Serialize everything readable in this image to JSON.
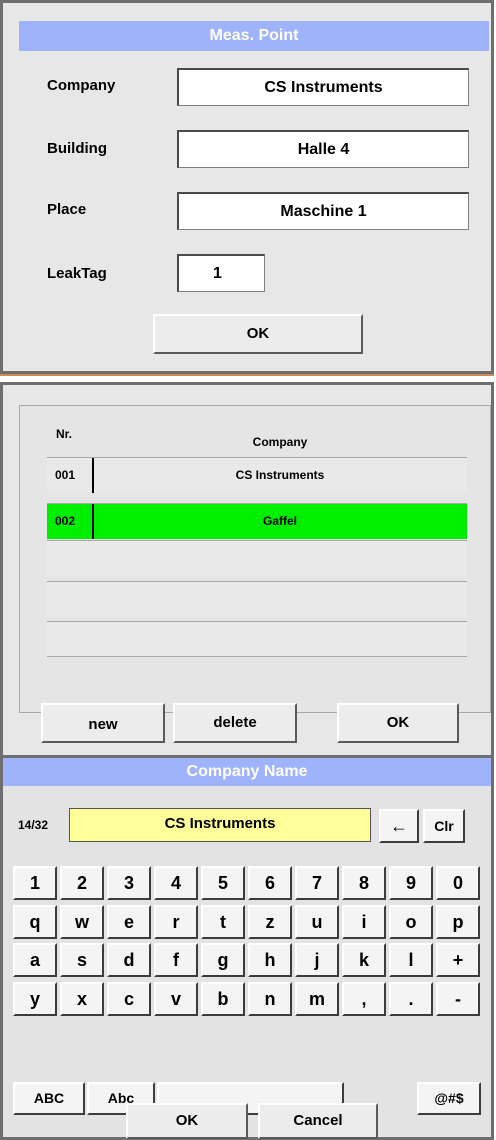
{
  "meas_point": {
    "title": "Meas. Point",
    "company_label": "Company",
    "company_value": "CS Instruments",
    "building_label": "Building",
    "building_value": "Halle 4",
    "place_label": "Place",
    "place_value": "Maschine 1",
    "leaktag_label": "LeakTag",
    "leaktag_value": "1",
    "ok_label": "OK"
  },
  "company_list": {
    "col_nr": "Nr.",
    "col_company": "Company",
    "rows": [
      {
        "nr": "001",
        "company": "CS Instruments",
        "selected": false
      },
      {
        "nr": "002",
        "company": "Gaffel",
        "selected": true
      },
      {
        "nr": "",
        "company": "",
        "selected": false
      },
      {
        "nr": "",
        "company": "",
        "selected": false
      },
      {
        "nr": "",
        "company": "",
        "selected": false
      }
    ],
    "new_label": "new",
    "delete_label": "delete",
    "ok_label": "OK",
    "selected_color": "#00ee00"
  },
  "keyboard": {
    "title": "Company Name",
    "counter": "14/32",
    "input_value": "CS Instruments",
    "backspace_label": "←",
    "clear_label": "Clr",
    "rows": [
      [
        "1",
        "2",
        "3",
        "4",
        "5",
        "6",
        "7",
        "8",
        "9",
        "0"
      ],
      [
        "q",
        "w",
        "e",
        "r",
        "t",
        "z",
        "u",
        "i",
        "o",
        "p"
      ],
      [
        "a",
        "s",
        "d",
        "f",
        "g",
        "h",
        "j",
        "k",
        "l",
        "+"
      ],
      [
        "y",
        "x",
        "c",
        "v",
        "b",
        "n",
        "m",
        ",",
        ".",
        "-"
      ]
    ],
    "abc_upper_label": "ABC",
    "abc_mixed_label": "Abc",
    "symbols_label": "@#$",
    "ok_label": "OK",
    "cancel_label": "Cancel",
    "input_color": "#ffff99"
  }
}
